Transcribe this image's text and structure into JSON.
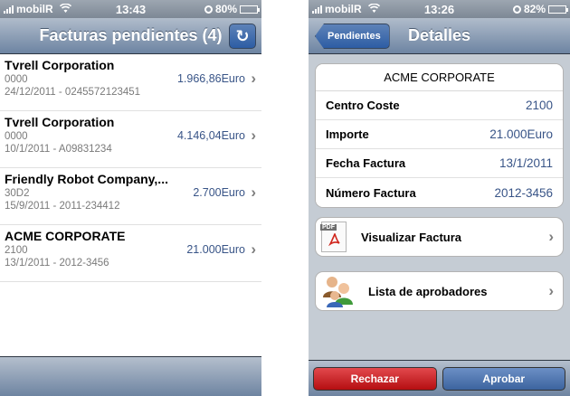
{
  "left_screen": {
    "status_bar": {
      "carrier": "mobilR",
      "time": "13:43",
      "battery": "80%",
      "battery_level": 0.8
    },
    "navbar": {
      "title": "Facturas pendientes (4)",
      "refresh_glyph": "↻"
    },
    "invoices": [
      {
        "company": "Tvrell Corporation",
        "code": "0000",
        "detail": "24/12/2011 - 0245572123451",
        "amount": "1.966,86Euro"
      },
      {
        "company": "Tvrell Corporation",
        "code": "0000",
        "detail": "10/1/2011 - A09831234",
        "amount": "4.146,04Euro"
      },
      {
        "company": "Friendly Robot Company,...",
        "code": "30D2",
        "detail": "15/9/2011 - 2011-234412",
        "amount": "2.700Euro"
      },
      {
        "company": "ACME CORPORATE",
        "code": "2100",
        "detail": "13/1/2011 - 2012-3456",
        "amount": "21.000Euro"
      }
    ]
  },
  "right_screen": {
    "status_bar": {
      "carrier": "mobilR",
      "time": "13:26",
      "battery": "82%",
      "battery_level": 0.82
    },
    "navbar": {
      "back_label": "Pendientes",
      "title": "Detalles"
    },
    "company": "ACME CORPORATE",
    "fields": [
      {
        "label": "Centro Coste",
        "value": "2100"
      },
      {
        "label": "Importe",
        "value": "21.000Euro"
      },
      {
        "label": "Fecha Factura",
        "value": "13/1/2011"
      },
      {
        "label": "Número Factura",
        "value": "2012-3456"
      }
    ],
    "actions": {
      "view_invoice": "Visualizar Factura",
      "approvers": "Lista de aprobadores",
      "pdf_tag": "PDF"
    },
    "toolbar": {
      "reject_label": "Rechazar",
      "approve_label": "Aprobar"
    }
  },
  "icons": {
    "chevron": "›",
    "wifi": "wifi-icon",
    "pdf": "pdf-file-icon",
    "people": "people-icon"
  },
  "colors": {
    "nav_top": "#b0bccb",
    "nav_bottom": "#6d84a2",
    "value_blue": "#385487",
    "reject_red": "#c0171b",
    "approve_blue": "#4a6fa8",
    "battery_green": "#5ad633"
  }
}
